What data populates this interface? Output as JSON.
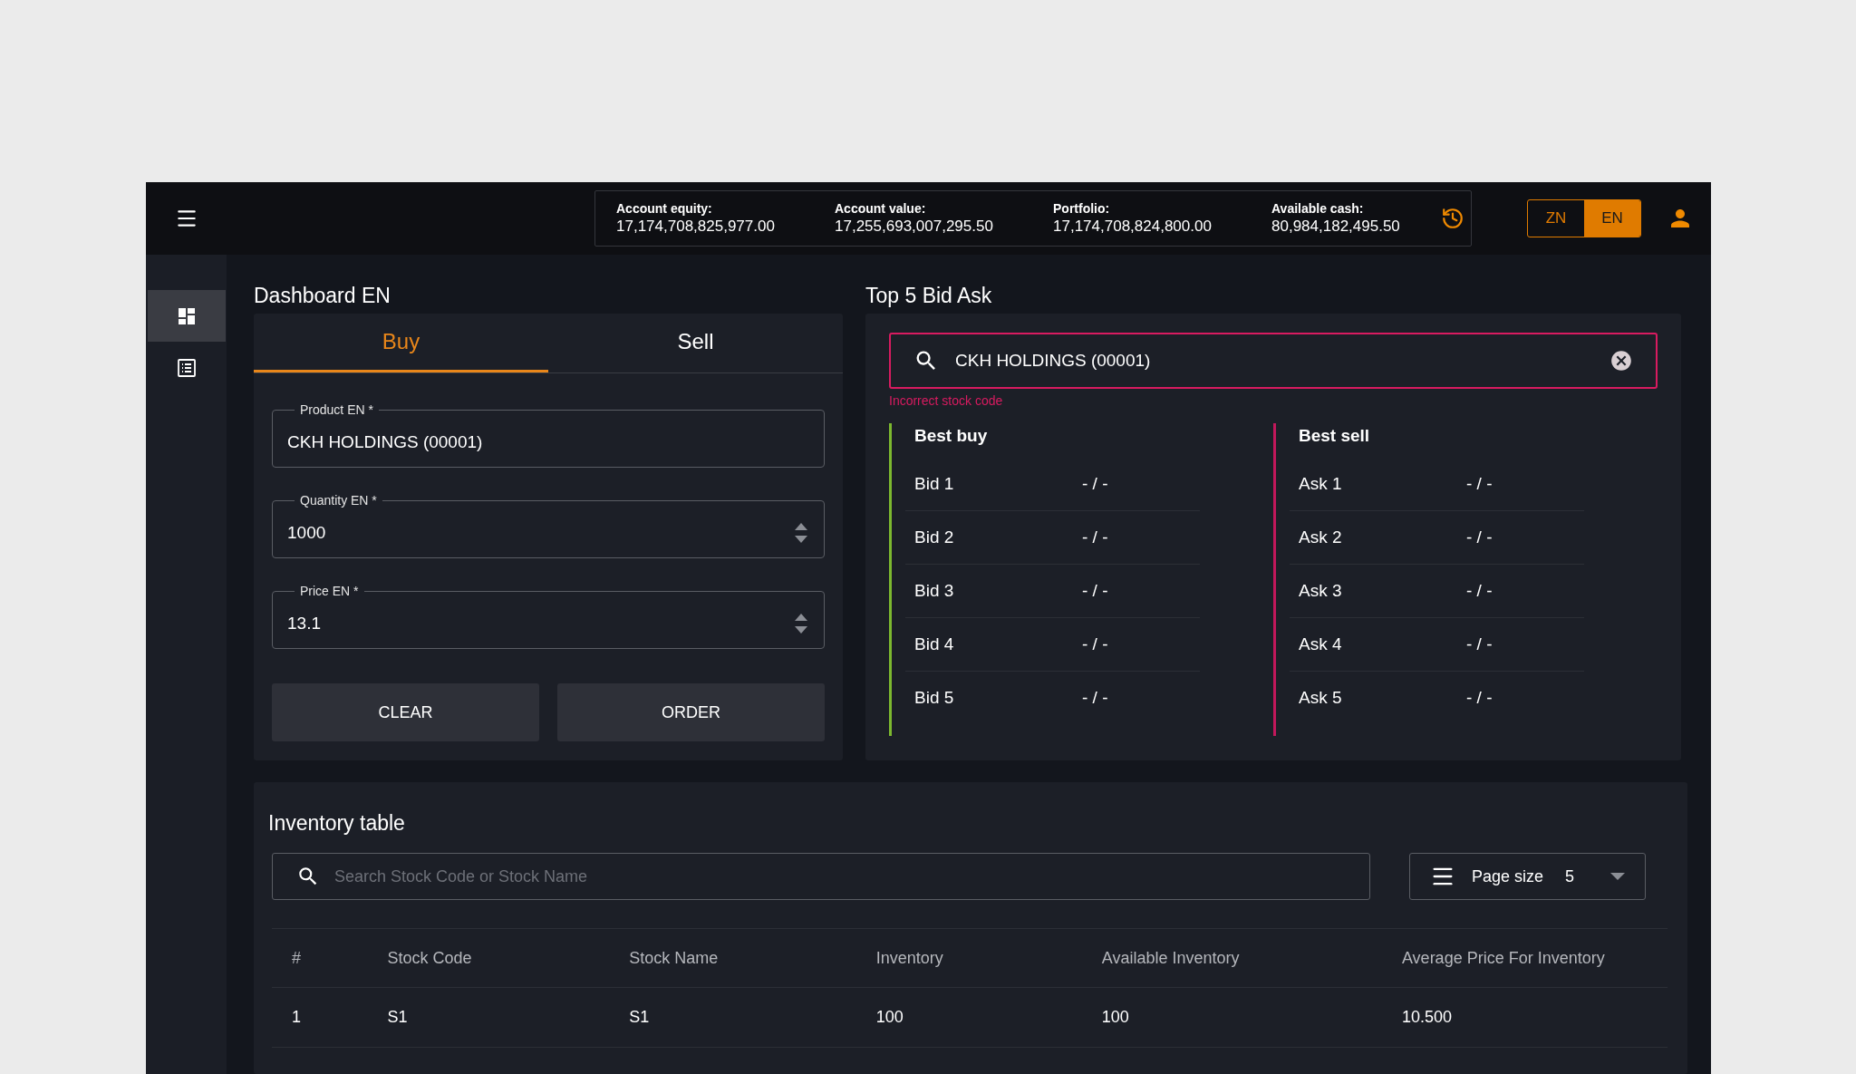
{
  "header": {
    "account_stats": [
      {
        "label": "Account equity:",
        "value": "17,174,708,825,977.00"
      },
      {
        "label": "Account value:",
        "value": "17,255,693,007,295.50"
      },
      {
        "label": "Portfolio:",
        "value": "17,174,708,824,800.00"
      },
      {
        "label": "Available cash:",
        "value": "80,984,182,495.50"
      }
    ],
    "languages": [
      {
        "label": "ZN",
        "selected": false
      },
      {
        "label": "EN",
        "selected": true
      }
    ]
  },
  "sidebar": {
    "items": [
      {
        "kind": "dashboard",
        "selected": true
      },
      {
        "kind": "list",
        "selected": false
      }
    ]
  },
  "order_form": {
    "title": "Dashboard EN",
    "tabs": [
      {
        "label": "Buy",
        "selected": true
      },
      {
        "label": "Sell",
        "selected": false
      }
    ],
    "fields": [
      {
        "label": "Product EN *",
        "value": "CKH HOLDINGS (00001)",
        "kind": "text"
      },
      {
        "label": "Quantity EN *",
        "value": "1000",
        "kind": "number"
      },
      {
        "label": "Price EN *",
        "value": "13.1",
        "kind": "number"
      }
    ],
    "buttons": [
      "CLEAR",
      "ORDER"
    ]
  },
  "bid_ask": {
    "title": "Top 5 Bid Ask",
    "search": {
      "value": "CKH HOLDINGS (00001)",
      "error": "Incorrect stock code"
    },
    "sides": [
      {
        "title": "Best buy",
        "color": "#7cb82f",
        "rows": [
          {
            "label": "Bid 1",
            "value": "- / -"
          },
          {
            "label": "Bid 2",
            "value": "- / -"
          },
          {
            "label": "Bid 3",
            "value": "- / -"
          },
          {
            "label": "Bid 4",
            "value": "- / -"
          },
          {
            "label": "Bid 5",
            "value": "- / -"
          }
        ]
      },
      {
        "title": "Best sell",
        "color": "#c2185b",
        "rows": [
          {
            "label": "Ask 1",
            "value": "- / -"
          },
          {
            "label": "Ask 2",
            "value": "- / -"
          },
          {
            "label": "Ask 3",
            "value": "- / -"
          },
          {
            "label": "Ask 4",
            "value": "- / -"
          },
          {
            "label": "Ask 5",
            "value": "- / -"
          }
        ]
      }
    ]
  },
  "inventory": {
    "title": "Inventory table",
    "search": {
      "placeholder": "Search Stock Code or Stock Name"
    },
    "page_size": {
      "label": "Page size",
      "value": "5"
    },
    "table": {
      "columns": [
        "#",
        "Stock Code",
        "Stock Name",
        "Inventory",
        "Available Inventory",
        "Average Price For Inventory"
      ],
      "rows": [
        [
          "1",
          "S1",
          "S1",
          "100",
          "100",
          "10.500"
        ]
      ]
    }
  }
}
